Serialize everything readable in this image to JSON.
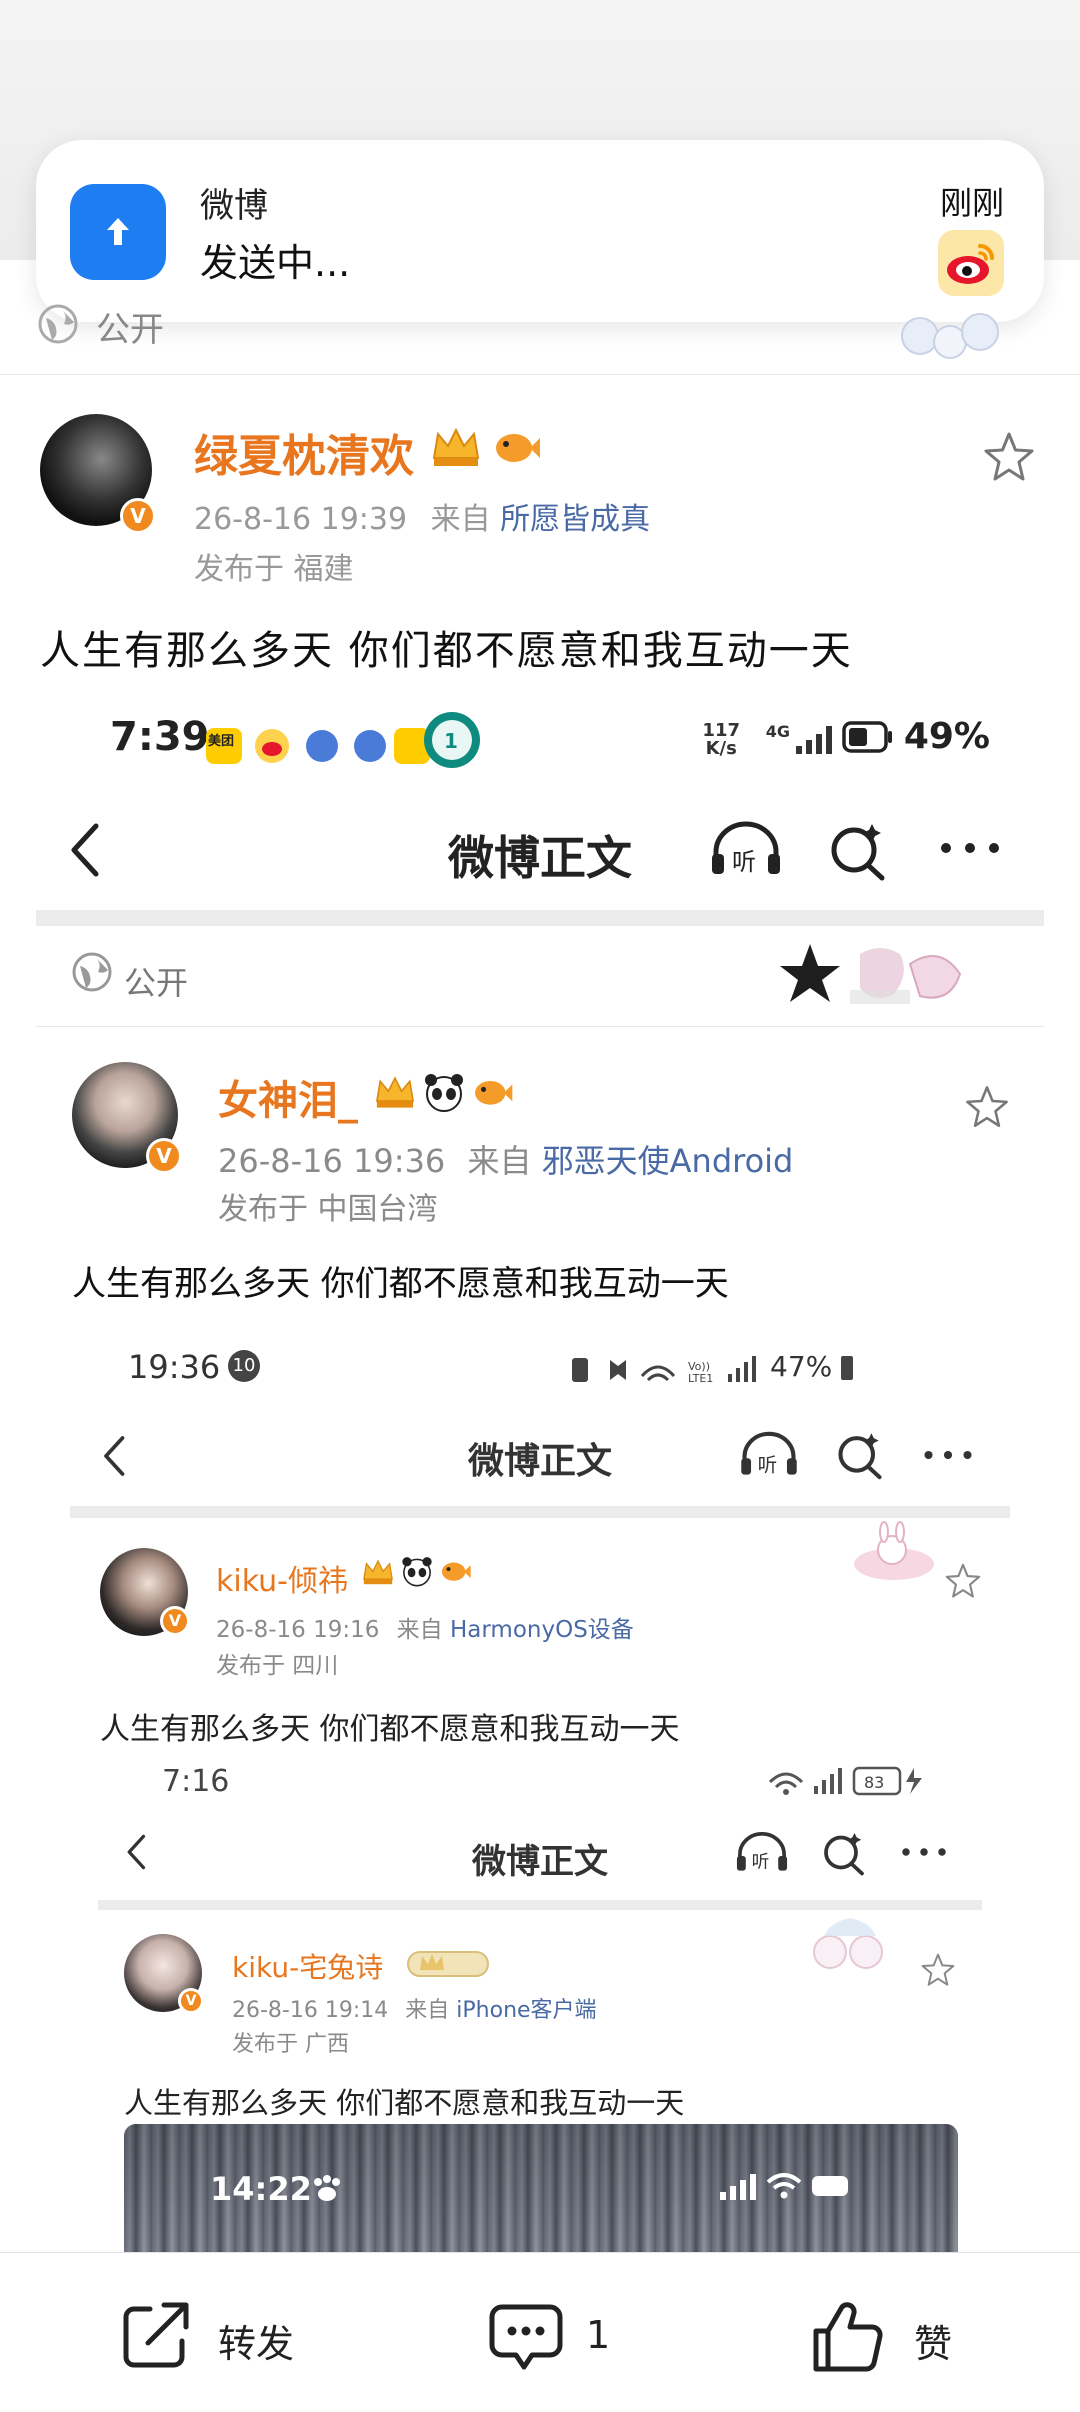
{
  "notification": {
    "app_name": "微博",
    "message": "发送中...",
    "time": "刚刚",
    "icon": "upload-arrow-icon"
  },
  "post": {
    "visibility": "公开",
    "username": "绿夏枕清欢",
    "date": "26-8-16 19:39",
    "source_prefix": "来自",
    "source": "所愿皆成真",
    "location": "发布于 福建",
    "content": "人生有那么多天 你们都不愿意和我互动一天"
  },
  "shot1": {
    "status_time": "7:39",
    "net_speed_top": "117",
    "net_speed_bottom": "K/s",
    "network": "4G",
    "battery": "49%",
    "nav_title": "微博正文",
    "visibility": "公开",
    "username": "女神泪_",
    "date": "26-8-16 19:36",
    "source_prefix": "来自",
    "source": "邪恶天使Android",
    "location": "发布于 中国台湾",
    "content": "人生有那么多天 你们都不愿意和我互动一天",
    "status_icon_label": "美团"
  },
  "shot2": {
    "status_time": "19:36",
    "notif_count": "10",
    "battery": "47%",
    "nav_title": "微博正文",
    "username": "kiku-倾祎",
    "date": "26-8-16 19:16",
    "source_prefix": "来自",
    "source": "HarmonyOS设备",
    "location": "发布于 四川",
    "content": "人生有那么多天 你们都不愿意和我互动一天"
  },
  "shot3": {
    "status_time": "7:16",
    "battery": "83",
    "nav_title": "微博正文",
    "username": "kiku-宅兔诗",
    "date": "26-8-16 19:14",
    "source_prefix": "来自",
    "source": "iPhone客户端",
    "location": "发布于 广西",
    "content": "人生有那么多天 你们都不愿意和我互动一天",
    "media_time": "14:22"
  },
  "actions": {
    "repost_label": "转发",
    "comment_count": "1",
    "like_label": "赞"
  },
  "colors": {
    "username_orange": "#e8761e",
    "source_blue": "#4a6aa5",
    "toast_icon_blue": "#1f7df2"
  }
}
